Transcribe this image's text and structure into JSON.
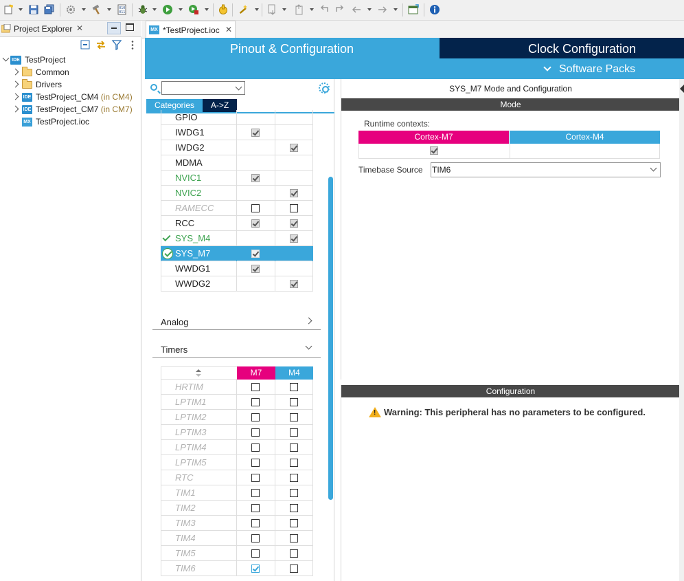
{
  "project_explorer": {
    "title": "Project Explorer",
    "tree": [
      {
        "label": "TestProject",
        "extra": "",
        "icon": "ide-project-icon"
      },
      {
        "label": "Common",
        "extra": "",
        "icon": "folder-icon"
      },
      {
        "label": "Drivers",
        "extra": "",
        "icon": "folder-icon"
      },
      {
        "label": "TestProject_CM4",
        "extra": " (in CM4)",
        "icon": "ide-project-icon"
      },
      {
        "label": "TestProject_CM7",
        "extra": " (in CM7)",
        "icon": "ide-project-icon"
      },
      {
        "label": "TestProject.ioc",
        "extra": "",
        "icon": "mx-file-icon"
      }
    ]
  },
  "editor": {
    "tab_label": "*TestProject.ioc",
    "icon_text": "MX",
    "ide_icon_text": "IDE"
  },
  "header": {
    "pinout_tab": "Pinout & Configuration",
    "clock_tab": "Clock Configuration",
    "software_packs": "Software Packs"
  },
  "categories": {
    "search_value": "",
    "tabs": [
      "Categories",
      "A->Z"
    ],
    "system_core_rows": [
      {
        "name": "GPIO",
        "m7": "",
        "m4": "",
        "style": "normal",
        "status": ""
      },
      {
        "name": "IWDG1",
        "m7": "checked",
        "m4": "",
        "style": "normal",
        "status": ""
      },
      {
        "name": "IWDG2",
        "m7": "",
        "m4": "checked",
        "style": "normal",
        "status": ""
      },
      {
        "name": "MDMA",
        "m7": "",
        "m4": "",
        "style": "normal",
        "status": ""
      },
      {
        "name": "NVIC1",
        "m7": "checked",
        "m4": "",
        "style": "green",
        "status": ""
      },
      {
        "name": "NVIC2",
        "m7": "",
        "m4": "checked",
        "style": "green",
        "status": ""
      },
      {
        "name": "RAMECC",
        "m7": "empty",
        "m4": "empty",
        "style": "gray",
        "status": ""
      },
      {
        "name": "RCC",
        "m7": "checked",
        "m4": "checked",
        "style": "normal",
        "status": ""
      },
      {
        "name": "SYS_M4",
        "m7": "",
        "m4": "checked",
        "style": "green",
        "status": "check"
      },
      {
        "name": "SYS_M7",
        "m7": "checked",
        "m4": "",
        "style": "selected",
        "status": "circle"
      },
      {
        "name": "WWDG1",
        "m7": "checked",
        "m4": "",
        "style": "normal",
        "status": ""
      },
      {
        "name": "WWDG2",
        "m7": "",
        "m4": "checked",
        "style": "normal",
        "status": ""
      }
    ],
    "analog_label": "Analog",
    "timers_label": "Timers",
    "timers_header": {
      "m7": "M7",
      "m4": "M4"
    },
    "timers_rows": [
      {
        "name": "HRTIM",
        "m7": "empty",
        "m4": "empty"
      },
      {
        "name": "LPTIM1",
        "m7": "empty",
        "m4": "empty"
      },
      {
        "name": "LPTIM2",
        "m7": "empty",
        "m4": "empty"
      },
      {
        "name": "LPTIM3",
        "m7": "empty",
        "m4": "empty"
      },
      {
        "name": "LPTIM4",
        "m7": "empty",
        "m4": "empty"
      },
      {
        "name": "LPTIM5",
        "m7": "empty",
        "m4": "empty"
      },
      {
        "name": "RTC",
        "m7": "empty",
        "m4": "empty"
      },
      {
        "name": "TIM1",
        "m7": "empty",
        "m4": "empty"
      },
      {
        "name": "TIM2",
        "m7": "empty",
        "m4": "empty"
      },
      {
        "name": "TIM3",
        "m7": "empty",
        "m4": "empty"
      },
      {
        "name": "TIM4",
        "m7": "empty",
        "m4": "empty"
      },
      {
        "name": "TIM5",
        "m7": "empty",
        "m4": "empty"
      },
      {
        "name": "TIM6",
        "m7": "checked-blue",
        "m4": "empty"
      }
    ]
  },
  "mode_panel": {
    "title": "SYS_M7 Mode and Configuration",
    "mode_bar": "Mode",
    "runtime_label": "Runtime contexts:",
    "cortex_m7": "Cortex-M7",
    "cortex_m4": "Cortex-M4",
    "timebase_label": "Timebase Source",
    "timebase_value": "TIM6"
  },
  "config_panel": {
    "bar": "Configuration",
    "warning": "Warning: This peripheral has no parameters to be configured."
  },
  "colors": {
    "accent_blue": "#3aa7db",
    "navy": "#03234b",
    "cortex_m7_magenta": "#e6007e",
    "panel_bar_gray": "#484848",
    "enabled_green": "#3ea350",
    "warning_yellow": "#f2b01e"
  }
}
